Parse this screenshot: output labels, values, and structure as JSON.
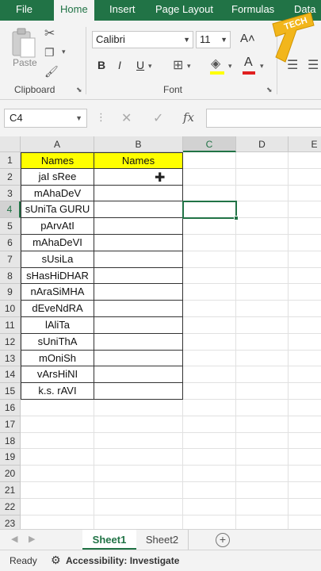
{
  "ribbon": {
    "tabs": [
      "File",
      "Home",
      "Insert",
      "Page Layout",
      "Formulas",
      "Data"
    ],
    "groups": {
      "clipboard": "Clipboard",
      "font": "Font"
    },
    "paste_label": "Paste",
    "font_name": "Calibri",
    "font_size": "11",
    "format_buttons": [
      "B",
      "I",
      "U"
    ]
  },
  "formula_bar": {
    "name_box": "C4",
    "formula_value": ""
  },
  "grid": {
    "columns": [
      "A",
      "B",
      "C",
      "D",
      "E"
    ],
    "rows": [
      "1",
      "2",
      "3",
      "4",
      "5",
      "6",
      "7",
      "8",
      "9",
      "10",
      "11",
      "12",
      "13",
      "14",
      "15",
      "16",
      "17",
      "18",
      "19",
      "20",
      "21",
      "22",
      "23"
    ],
    "selected_cell": "C4",
    "col_a": [
      "Names",
      "jaI sRee",
      "mAhaDeV",
      "sUniTa  GURU",
      "pArvAtI",
      "mAhaDeVI",
      "sUsiLa",
      "sHasHiDHAR",
      "nAraSiMHA",
      "dEveNdRA",
      "lAliTa",
      "sUniThA",
      "mOniSh",
      "vArsHiNI",
      "k.s. rAVI"
    ],
    "col_b_header": "Names"
  },
  "sheets": {
    "tabs": [
      "Sheet1",
      "Sheet2"
    ],
    "active": "Sheet1"
  },
  "status": {
    "ready": "Ready",
    "accessibility": "Accessibility: Investigate"
  },
  "logo_text": "TECH"
}
